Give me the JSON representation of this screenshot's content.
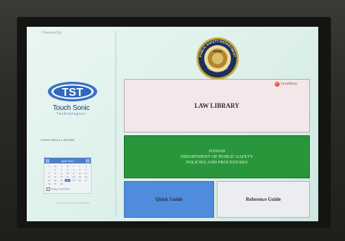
{
  "left_panel": {
    "powered_by": "Powered By:",
    "brand_name": "Touch Sonic",
    "brand_subtitle": "Technologies",
    "station_id": "KIOSK-000014-1-INC9988",
    "calendar": {
      "month": "April 2013",
      "prev": "<",
      "next": ">",
      "days": [
        "S",
        "M",
        "T",
        "W",
        "T",
        "F",
        "S",
        "",
        "1",
        "2",
        "3",
        "4",
        "5",
        "6",
        "7",
        "8",
        "9",
        "10",
        "11",
        "12",
        "13",
        "14",
        "15",
        "16",
        "17",
        "18",
        "19",
        "20",
        "21",
        "22",
        "23",
        "24",
        "25",
        "26",
        "27",
        "28",
        "29",
        "30",
        "",
        "",
        "",
        ""
      ],
      "selected_day": "24",
      "today_label": "Today: 4/12/2013"
    },
    "footnote": "Copyright Touch Sonic Technologies"
  },
  "header": {
    "seal_text_top": "PUBLIC SAFETY DEPARTMENT",
    "seal_text_mid": "HAWAII",
    "seal_text_bottom": "CORRECTIONS"
  },
  "main": {
    "law_library_label": "LAW LIBRARY",
    "lexis_label": "LexisNexis",
    "hawaii_lines": [
      "HAWAII",
      "DEPARTMENT OF PUBLIC SAFETY",
      "POLICIES AND PROCEDURES"
    ],
    "quick_guide_label": "Quick Guide",
    "reference_guide_label": "Reference Guide"
  },
  "colors": {
    "screen_bg": "#e2f3ee",
    "law_library_bg": "#f4e7ea",
    "policies_bg": "#29963b",
    "quick_guide_bg": "#4f8cdc",
    "reference_guide_bg": "#ecedf0",
    "brand_blue": "#1c3a66"
  }
}
